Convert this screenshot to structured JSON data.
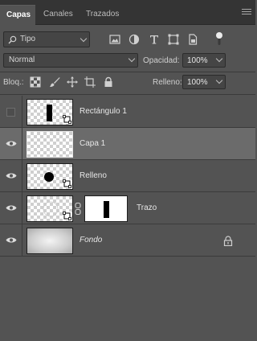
{
  "tabs": [
    {
      "label": "Capas",
      "active": true
    },
    {
      "label": "Canales",
      "active": false
    },
    {
      "label": "Trazados",
      "active": false
    }
  ],
  "filter": {
    "kind_label": "Tipo",
    "icons": [
      "image-filter-icon",
      "adjustment-filter-icon",
      "type-filter-icon",
      "shape-filter-icon",
      "smart-object-filter-icon",
      "filter-toggle-icon"
    ]
  },
  "blend": {
    "mode": "Normal",
    "opacity_label": "Opacidad:",
    "opacity_value": "100%"
  },
  "lock": {
    "label": "Bloq.:",
    "icons": [
      "lock-transparent-pixels-icon",
      "lock-image-pixels-icon",
      "lock-position-icon",
      "lock-artboard-icon",
      "lock-all-icon"
    ],
    "fill_label": "Relleno:",
    "fill_value": "100%"
  },
  "layers": [
    {
      "name": "Rectángulo 1",
      "visible": false,
      "selected": false,
      "italic": false
    },
    {
      "name": "Capa 1",
      "visible": true,
      "selected": true,
      "italic": false
    },
    {
      "name": "Relleno",
      "visible": true,
      "selected": false,
      "italic": false
    },
    {
      "name": "Trazo",
      "visible": true,
      "selected": false,
      "italic": false
    },
    {
      "name": "Fondo",
      "visible": true,
      "selected": false,
      "italic": true,
      "locked": true
    }
  ],
  "colors": {
    "panel": "#535353",
    "tabbar": "#343434",
    "selected_row": "#6b6b6b"
  }
}
